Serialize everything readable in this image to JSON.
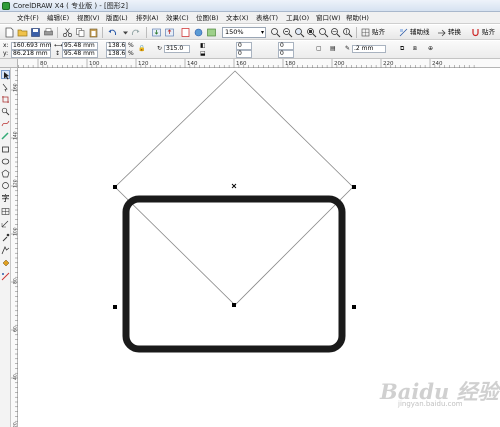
{
  "window": {
    "title": "CorelDRAW X4 ( 专业版 ) - [图形2]"
  },
  "menubar": {
    "items": [
      "文件(F)",
      "编辑(E)",
      "视图(V)",
      "版面(L)",
      "排列(A)",
      "效果(C)",
      "位图(B)",
      "文本(X)",
      "表格(T)",
      "工具(O)",
      "窗口(W)",
      "帮助(H)"
    ]
  },
  "toolbar": {
    "zoom_value": "150%",
    "snap_label": "贴齐",
    "connector_label": "辅助线",
    "convert_label": "转换",
    "paste_label": "贴齐"
  },
  "property_bar": {
    "x_label": "x:",
    "x_value": "160.693 mm",
    "y_label": "y:",
    "y_value": "86.218 mm",
    "width_value": "95.48 mm",
    "height_value": "95.48 mm",
    "scale_x": "138.6",
    "scale_y": "138.6",
    "percent": "%",
    "rotation_value": "315.0",
    "corner_values": [
      "0",
      "0",
      "0",
      "0"
    ],
    "outline_value": ".2 mm"
  },
  "ruler": {
    "h_ticks": [
      "80",
      "100",
      "120",
      "140",
      "160",
      "180",
      "200",
      "220",
      "240"
    ],
    "v_ticks": [
      "160",
      "140",
      "120",
      "100",
      "80",
      "60",
      "40",
      "20"
    ]
  },
  "canvas": {
    "shapes": [
      "rotated-square-outline",
      "rounded-rectangle"
    ]
  },
  "watermark": {
    "main": "Baidu 经验",
    "sub": "jingyan.baidu.com"
  },
  "colors": {
    "title_bg": "#d6e2f1",
    "canvas_bg": "#ffffff",
    "rect_stroke": "#1a1a1a",
    "diamond_stroke": "#8a8a8a"
  }
}
